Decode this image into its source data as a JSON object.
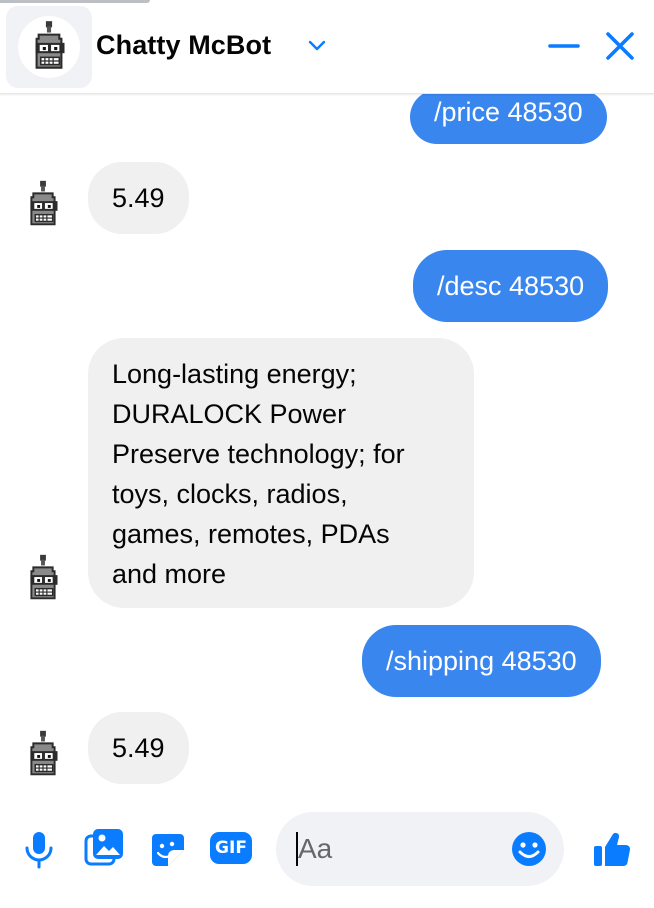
{
  "header": {
    "title": "Chatty McBot"
  },
  "messages": [
    {
      "dir": "out",
      "text": "/price 48530"
    },
    {
      "dir": "in",
      "text": "5.49"
    },
    {
      "dir": "out",
      "text": "/desc 48530"
    },
    {
      "dir": "in",
      "lines": [
        "Long-lasting energy;",
        "DURALOCK Power",
        "Preserve technology; for",
        "toys, clocks, radios,",
        "games, remotes, PDAs",
        "and more"
      ]
    },
    {
      "dir": "out",
      "text": "/shipping 48530"
    },
    {
      "dir": "in",
      "text": "5.49"
    }
  ],
  "composer": {
    "placeholder": "Aa",
    "gif_label": "GIF"
  },
  "colors": {
    "accent": "#0a7cff",
    "outgoing_bubble": "#3a86ef",
    "incoming_bubble": "#f0f0f0"
  },
  "icons": [
    "microphone-icon",
    "photo-icon",
    "sticker-icon",
    "gif-icon",
    "emoji-icon",
    "thumbs-up-icon",
    "minimize-icon",
    "close-icon",
    "chevron-down-icon"
  ]
}
